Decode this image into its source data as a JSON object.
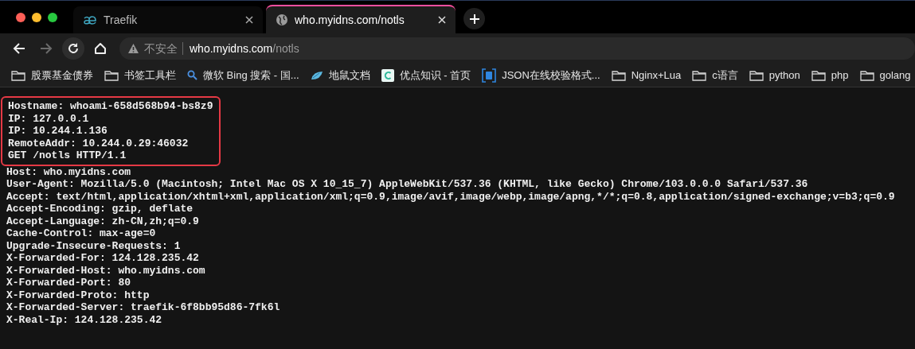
{
  "tabs": [
    {
      "title": "Traefik",
      "kind": "app",
      "selected": false
    },
    {
      "title": "who.myidns.com/notls",
      "kind": "web",
      "selected": true
    }
  ],
  "nav": [
    {
      "kind": "back",
      "disabled": false
    },
    {
      "kind": "forward",
      "disabled": true
    },
    {
      "kind": "reload",
      "disabled": false
    },
    {
      "kind": "home",
      "disabled": false
    }
  ],
  "address_bar": {
    "security": "不安全",
    "host": "who.myidns.com",
    "path": "/notls"
  },
  "bookmarks": [
    {
      "kind": "folder",
      "label": "股票基金债券"
    },
    {
      "kind": "folder",
      "label": "书签工具栏"
    },
    {
      "kind": "search",
      "label": "微软 Bing 搜索 - 国..."
    },
    {
      "kind": "fish",
      "label": "地鼠文档"
    },
    {
      "kind": "circle",
      "label": "优点知识 - 首页"
    },
    {
      "kind": "bracket",
      "label": "JSON在线校验格式..."
    },
    {
      "kind": "folder",
      "label": "Nginx+Lua"
    },
    {
      "kind": "folder",
      "label": "c语言"
    },
    {
      "kind": "folder",
      "label": "python"
    },
    {
      "kind": "folder",
      "label": "php"
    },
    {
      "kind": "folder",
      "label": "golang"
    }
  ],
  "content": [
    {
      "highlighted": true,
      "lines": [
        "Hostname: whoami-658d568b94-bs8z9",
        "IP: 127.0.0.1",
        "IP: 10.244.1.136",
        "RemoteAddr: 10.244.0.29:46032",
        "GET /notls HTTP/1.1"
      ]
    },
    {
      "highlighted": false,
      "lines": [
        "Host: who.myidns.com",
        "User-Agent: Mozilla/5.0 (Macintosh; Intel Mac OS X 10_15_7) AppleWebKit/537.36 (KHTML, like Gecko) Chrome/103.0.0.0 Safari/537.36",
        "Accept: text/html,application/xhtml+xml,application/xml;q=0.9,image/avif,image/webp,image/apng,*/*;q=0.8,application/signed-exchange;v=b3;q=0.9",
        "Accept-Encoding: gzip, deflate",
        "Accept-Language: zh-CN,zh;q=0.9",
        "Cache-Control: max-age=0",
        "Upgrade-Insecure-Requests: 1",
        "X-Forwarded-For: 124.128.235.42",
        "X-Forwarded-Host: who.myidns.com",
        "X-Forwarded-Port: 80",
        "X-Forwarded-Proto: http",
        "X-Forwarded-Server: traefik-6f8bb95d86-7fk6l",
        "X-Real-Ip: 124.128.235.42"
      ]
    }
  ]
}
